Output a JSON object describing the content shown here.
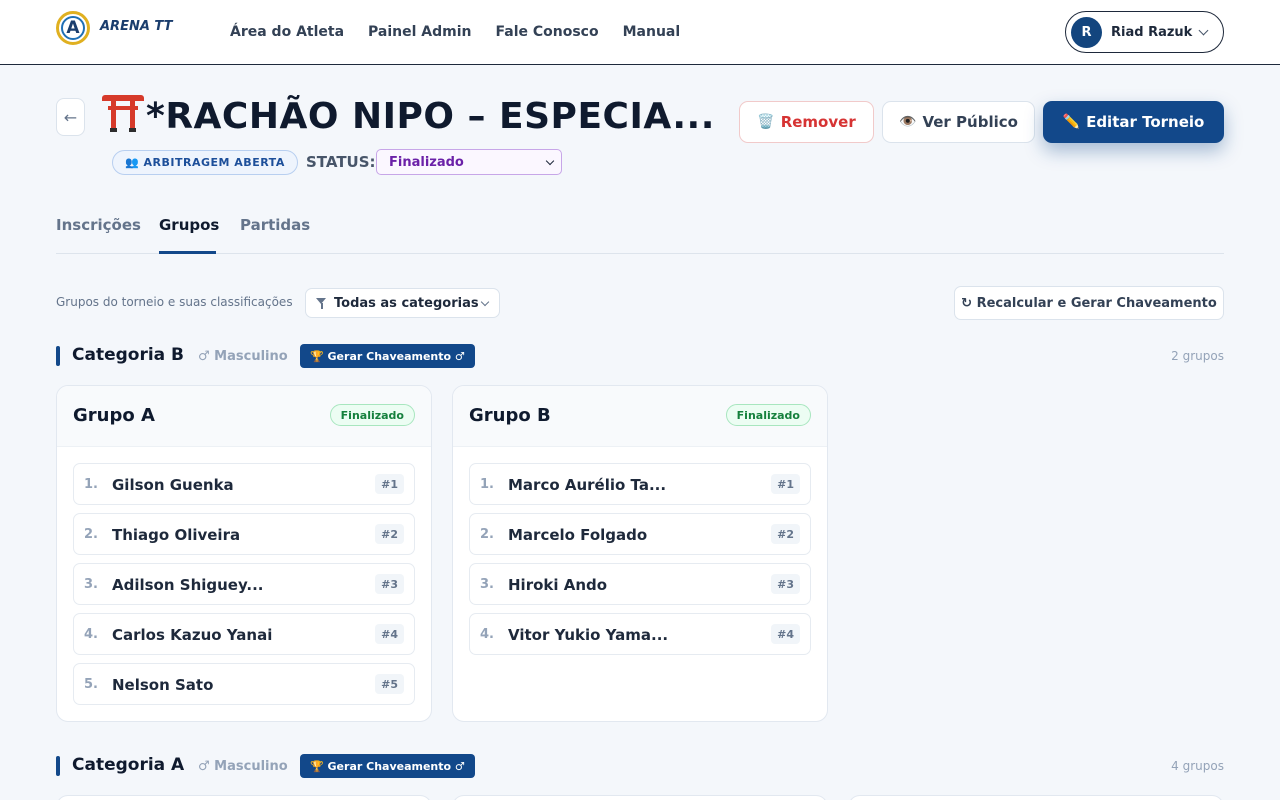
{
  "nav": {
    "logo_text": "ARENA TT",
    "logo_letter": "A",
    "links": [
      "Área do Atleta",
      "Painel Admin",
      "Fale Conosco",
      "Manual"
    ],
    "user": {
      "initial": "R",
      "name": "Riad Razuk"
    }
  },
  "header": {
    "back_arrow": "←",
    "title": "*RACHÃO NIPO – ESPECIA...",
    "arbitration_badge": "👥 ARBITRAGEM ABERTA",
    "status_label": "STATUS:",
    "status_value": "Finalizado",
    "buttons": {
      "remove": {
        "icon": "🗑️",
        "label": "Remover"
      },
      "public": {
        "icon": "👁️",
        "label": "Ver Público"
      },
      "edit": {
        "icon": "✏️",
        "label": "Editar Torneio"
      }
    }
  },
  "tabs": [
    "Inscrições",
    "Grupos",
    "Partidas"
  ],
  "active_tab": "Grupos",
  "filter": {
    "caption": "Grupos do torneio e suas classificações",
    "category_select": "Todas as categorias",
    "recalc_button": "↻ Recalcular e Gerar Chaveamento"
  },
  "categories": [
    {
      "title": "Categoria B",
      "gender": "♂ Masculino",
      "generate_button": "🏆 Gerar Chaveamento ♂",
      "count": "2 grupos",
      "groups": [
        {
          "title": "Grupo A",
          "status": "Finalizado",
          "players": [
            {
              "num": "1.",
              "name": "Gilson Guenka",
              "seed": "#1"
            },
            {
              "num": "2.",
              "name": "Thiago Oliveira",
              "seed": "#2"
            },
            {
              "num": "3.",
              "name": "Adilson Shiguey...",
              "seed": "#3"
            },
            {
              "num": "4.",
              "name": "Carlos Kazuo Yanai",
              "seed": "#4"
            },
            {
              "num": "5.",
              "name": "Nelson Sato",
              "seed": "#5"
            }
          ]
        },
        {
          "title": "Grupo B",
          "status": "Finalizado",
          "players": [
            {
              "num": "1.",
              "name": "Marco Aurélio Ta...",
              "seed": "#1"
            },
            {
              "num": "2.",
              "name": "Marcelo Folgado",
              "seed": "#2"
            },
            {
              "num": "3.",
              "name": "Hiroki Ando",
              "seed": "#3"
            },
            {
              "num": "4.",
              "name": "Vitor Yukio Yama...",
              "seed": "#4"
            }
          ]
        }
      ]
    },
    {
      "title": "Categoria A",
      "gender": "♂ Masculino",
      "generate_button": "🏆 Gerar Chaveamento ♂",
      "count": "4 grupos"
    }
  ],
  "colors": {
    "primary": "#12488a",
    "danger": "#d63333",
    "success": "#15803d",
    "status_purple": "#6b21a8",
    "background": "#f4f7fb"
  }
}
